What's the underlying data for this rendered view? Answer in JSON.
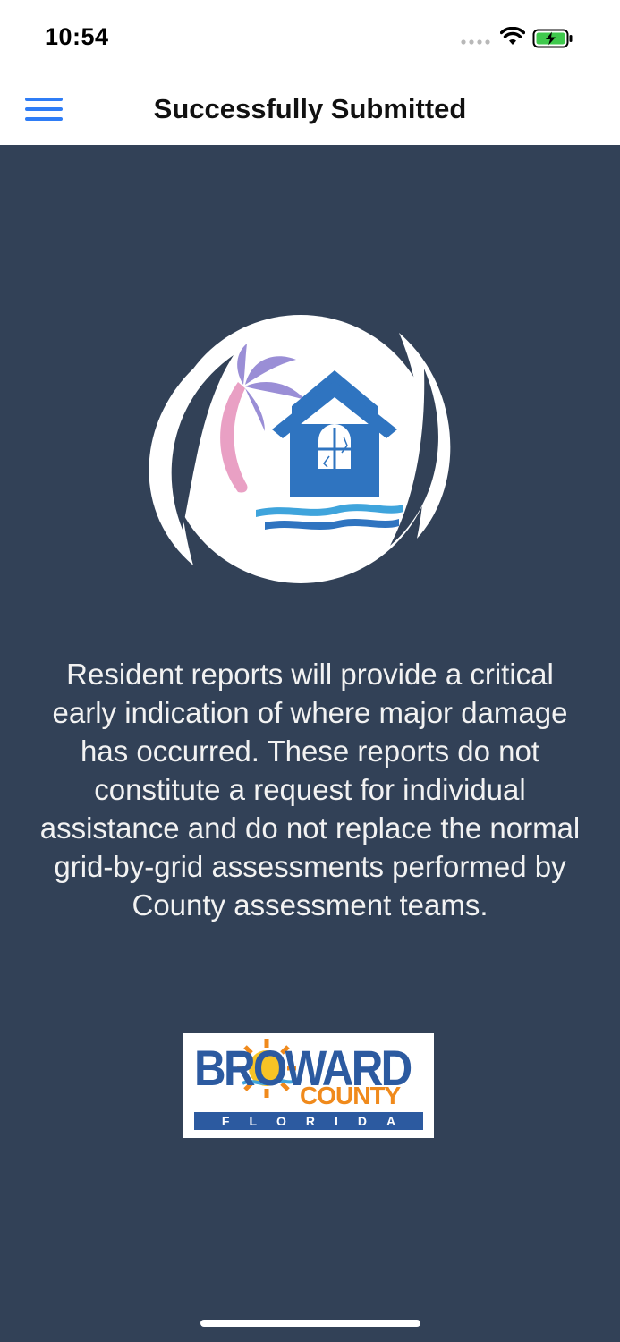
{
  "status_bar": {
    "time": "10:54",
    "icons": [
      "signal-dots-icon",
      "wifi-icon",
      "battery-charging-icon"
    ]
  },
  "nav": {
    "title": "Successfully Submitted",
    "menu_icon": "hamburger-menu-icon"
  },
  "main": {
    "app_logo": "house-hurricane-logo",
    "disclaimer": "Resident reports will provide a critical early indication of where major damage has occurred. These reports do not constitute a request for individual assistance and do not replace the normal grid-by-grid assessments performed by County assessment teams.",
    "county_logo": {
      "line1": "BROWARD",
      "line2": "COUNTY",
      "line3": "FLORIDA"
    }
  },
  "colors": {
    "background": "#324157",
    "accent": "#2f7df6",
    "logo_blue": "#2c5aa0",
    "logo_orange": "#f08a1c"
  }
}
